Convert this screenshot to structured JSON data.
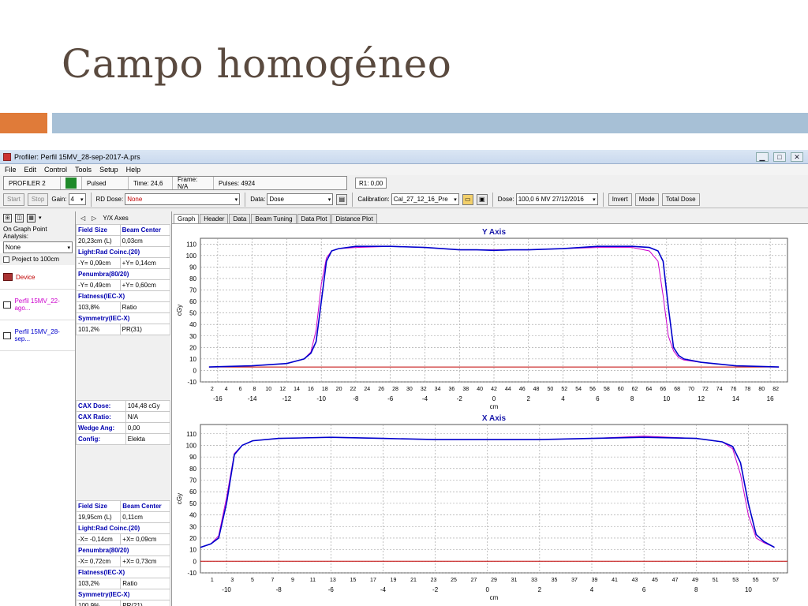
{
  "slide": {
    "title": "Campo homogéneo"
  },
  "window": {
    "title": "Profiler: Perfil 15MV_28-sep-2017-A.prs",
    "controls": {
      "minimize": "▁",
      "maximize": "□",
      "close": "✕"
    }
  },
  "menu": [
    "File",
    "Edit",
    "Control",
    "Tools",
    "Setup",
    "Help"
  ],
  "status": {
    "device": "PROFILER 2",
    "mode": "Pulsed",
    "time": "Time: 24,6",
    "frame": "Frame: N/A",
    "pulses": "Pulses: 4924",
    "r1": "R1: 0,00"
  },
  "toolbar": {
    "start": "Start",
    "stop": "Stop",
    "gain_label": "Gain:",
    "gain_value": "4",
    "rd_dose_label": "RD Dose:",
    "rd_dose_value": "None",
    "data_label": "Data:",
    "data_value": "Dose",
    "calibration_label": "Calibration:",
    "calibration_value": "Cal_27_12_16_Pre",
    "dose_label": "Dose:",
    "dose_value": "100,0 6 MV 27/12/2016",
    "invert": "Invert",
    "mode": "Mode",
    "total_dose": "Total Dose"
  },
  "left_panel": {
    "analysis_label": "On Graph Point Analysis:",
    "analysis_value": "None",
    "project_label": "Project to 100cm",
    "items": [
      {
        "label": "Device",
        "color": "#c00000"
      },
      {
        "label": "Perfil 15MV_22-ago...",
        "color": "#cc00cc"
      },
      {
        "label": "Perfil 15MV_28-sep...",
        "color": "#0000cc"
      }
    ]
  },
  "mid_panel": {
    "axes_label": "Y/X Axes",
    "y_table": [
      [
        "Field Size",
        "Beam Center"
      ],
      [
        "20,23cm (L)",
        "0,03cm"
      ],
      [
        "Light:Rad Coinc.(20)",
        ""
      ],
      [
        "-Y= 0,09cm",
        "+Y= 0,14cm"
      ],
      [
        "Penumbra(80/20)",
        ""
      ],
      [
        "-Y= 0,49cm",
        "+Y= 0,60cm"
      ],
      [
        "Flatness(IEC-X)",
        ""
      ],
      [
        "103,8%",
        "Ratio"
      ],
      [
        "Symmetry(IEC-X)",
        ""
      ],
      [
        "101,2%",
        "PR(31)"
      ]
    ],
    "cax_table": [
      [
        "CAX Dose:",
        "104,48 cGy"
      ],
      [
        "CAX Ratio:",
        "N/A"
      ],
      [
        "Wedge Ang:",
        "0,00"
      ],
      [
        "Config:",
        "Elekta"
      ]
    ],
    "x_table": [
      [
        "Field Size",
        "Beam Center"
      ],
      [
        "19,95cm (L)",
        "0,11cm"
      ],
      [
        "Light:Rad Coinc.(20)",
        ""
      ],
      [
        "-X= -0,14cm",
        "+X= 0,09cm"
      ],
      [
        "Penumbra(80/20)",
        ""
      ],
      [
        "-X= 0,72cm",
        "+X= 0,73cm"
      ],
      [
        "Flatness(IEC-X)",
        ""
      ],
      [
        "103,2%",
        "Ratio"
      ],
      [
        "Symmetry(IEC-X)",
        ""
      ],
      [
        "100,9%",
        "PR(21)"
      ]
    ]
  },
  "tabs": [
    "Graph",
    "Header",
    "Data",
    "Beam Tuning",
    "Data Plot",
    "Distance Plot"
  ],
  "chart_data": [
    {
      "type": "line",
      "title": "Y Axis",
      "xlabel": "cm",
      "ylabel": "cGy",
      "xlim": [
        -17,
        17
      ],
      "ylim": [
        -10,
        115
      ],
      "x_ticks": [
        -16,
        -14,
        -12,
        -10,
        -8,
        -6,
        -4,
        -2,
        0,
        2,
        4,
        6,
        8,
        10,
        12,
        14,
        16
      ],
      "y_ticks": [
        -10,
        0,
        10,
        20,
        30,
        40,
        50,
        60,
        70,
        80,
        90,
        100,
        110
      ],
      "detector_labels": [
        "2",
        "4",
        "6",
        "8",
        "10",
        "12",
        "14",
        "16",
        "18",
        "20",
        "22",
        "24",
        "26",
        "28",
        "30",
        "32",
        "34",
        "36",
        "38",
        "40",
        "42",
        "44",
        "46",
        "48",
        "50",
        "52",
        "54",
        "56",
        "58",
        "60",
        "62",
        "64",
        "66",
        "68",
        "70",
        "72",
        "74",
        "76",
        "78",
        "80",
        "82"
      ],
      "grid": true,
      "series": [
        {
          "name": "Perfil 15MV_28-sep...",
          "color": "#0000cc",
          "x": [
            -16.5,
            -14,
            -12,
            -11,
            -10.6,
            -10.3,
            -10.0,
            -9.7,
            -9.4,
            -9,
            -8,
            -6,
            -4,
            -2,
            -1,
            0,
            1,
            2,
            4,
            6,
            7,
            8,
            9,
            9.5,
            9.8,
            10.1,
            10.4,
            10.7,
            11,
            12,
            14,
            16.5
          ],
          "y": [
            3,
            4,
            6,
            10,
            15,
            25,
            60,
            95,
            104,
            106,
            108,
            108,
            107,
            105,
            105,
            104.5,
            105,
            105,
            106,
            108,
            108,
            108,
            107,
            104,
            95,
            55,
            20,
            13,
            10,
            7,
            4,
            3
          ]
        },
        {
          "name": "Perfil 15MV_22-ago...",
          "color": "#cc00cc",
          "x": [
            -16.5,
            -14,
            -12,
            -11,
            -10.6,
            -10.3,
            -10.0,
            -9.7,
            -9.4,
            -9,
            -8,
            -6,
            -4,
            -2,
            0,
            2,
            4,
            6,
            8,
            9,
            9.5,
            9.8,
            10.1,
            10.4,
            10.7,
            11,
            12,
            14,
            16.5
          ],
          "y": [
            3,
            4,
            6,
            10,
            16,
            35,
            75,
            98,
            104,
            106,
            107,
            108,
            107,
            105,
            105,
            105,
            106,
            107,
            107,
            104,
            95,
            65,
            30,
            17,
            11,
            9,
            7,
            4,
            3
          ]
        },
        {
          "name": "Device",
          "color": "#c00000",
          "x": [
            -16.5,
            16.5
          ],
          "y": [
            3,
            3
          ]
        }
      ]
    },
    {
      "type": "line",
      "title": "X Axis",
      "xlabel": "cm",
      "ylabel": "cGy",
      "xlim": [
        -11,
        11.5
      ],
      "ylim": [
        -10,
        118
      ],
      "x_ticks": [
        -10,
        -8,
        -6,
        -4,
        -2,
        0,
        2,
        4,
        6,
        8,
        10
      ],
      "y_ticks": [
        -10,
        0,
        10,
        20,
        30,
        40,
        50,
        60,
        70,
        80,
        90,
        100,
        110
      ],
      "detector_labels": [
        "1",
        "3",
        "5",
        "7",
        "9",
        "11",
        "13",
        "15",
        "17",
        "19",
        "21",
        "23",
        "25",
        "27",
        "29",
        "31",
        "33",
        "35",
        "37",
        "39",
        "41",
        "43",
        "45",
        "47",
        "49",
        "51",
        "53",
        "55",
        "57"
      ],
      "grid": true,
      "series": [
        {
          "name": "Perfil 15MV_28-sep...",
          "color": "#0000cc",
          "x": [
            -11,
            -10.6,
            -10.3,
            -10.0,
            -9.7,
            -9.4,
            -9,
            -8,
            -6,
            -4,
            -2,
            0,
            2,
            4,
            6,
            8,
            9,
            9.4,
            9.7,
            10.0,
            10.3,
            10.6,
            11
          ],
          "y": [
            12,
            15,
            20,
            50,
            92,
            100,
            104,
            106,
            107,
            106,
            105,
            105,
            105,
            106,
            107,
            106,
            103,
            99,
            85,
            50,
            23,
            17,
            12
          ]
        },
        {
          "name": "Perfil 15MV_22-ago...",
          "color": "#cc00cc",
          "x": [
            -11,
            -10.6,
            -10.3,
            -10.0,
            -9.7,
            -9.4,
            -9,
            -8,
            -6,
            -4,
            -2,
            0,
            2,
            4,
            6,
            8,
            9,
            9.4,
            9.7,
            10.0,
            10.3,
            10.6,
            11
          ],
          "y": [
            12,
            15,
            22,
            55,
            93,
            100,
            104,
            106,
            107,
            106,
            105,
            105,
            105,
            106,
            108,
            106,
            103,
            97,
            75,
            40,
            20,
            16,
            12
          ]
        },
        {
          "name": "Device",
          "color": "#c00000",
          "x": [
            -11,
            11.5
          ],
          "y": [
            0,
            0
          ]
        }
      ]
    }
  ]
}
